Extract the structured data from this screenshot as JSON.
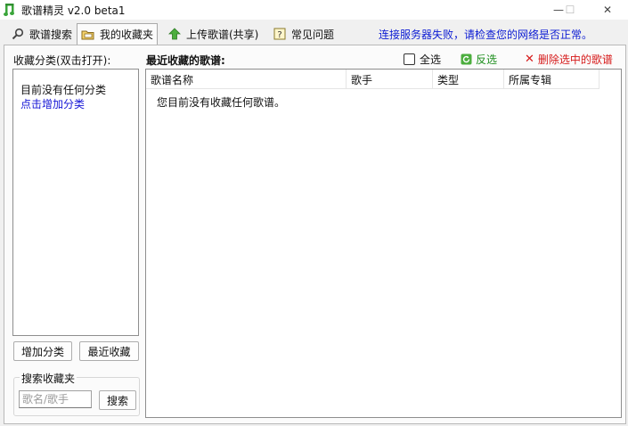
{
  "window": {
    "title": "歌谱精灵 v2.0 beta1",
    "minimize": "—",
    "maximize": "☐",
    "close": "✕"
  },
  "tabs": [
    {
      "label": "歌谱搜索",
      "icon": "magnifier-icon"
    },
    {
      "label": "我的收藏夹",
      "icon": "folder-icon"
    },
    {
      "label": "上传歌谱(共享)",
      "icon": "up-arrow-icon"
    },
    {
      "label": "常见问题",
      "icon": "help-icon"
    }
  ],
  "status_message": "连接服务器失败，请检查您的网络是否正常。",
  "categories": {
    "heading": "收藏分类(双击打开):",
    "empty_text": "目前没有任何分类",
    "add_link": "点击增加分类",
    "add_button": "增加分类",
    "recent_button": "最近收藏"
  },
  "search_favorites": {
    "title": "搜索收藏夹",
    "placeholder": "歌名/歌手",
    "button": "搜索"
  },
  "recent": {
    "heading": "最近收藏的歌谱:",
    "select_all": "全选",
    "invert": "反选",
    "delete": "删除选中的歌谱",
    "columns": [
      "歌谱名称",
      "歌手",
      "类型",
      "所属专辑"
    ],
    "empty_text": "您目前没有收藏任何歌谱。"
  },
  "colors": {
    "status": "#0b1bd3",
    "link": "#1616d6",
    "invert": "#1c8e1c",
    "delete": "#d61a1a"
  }
}
